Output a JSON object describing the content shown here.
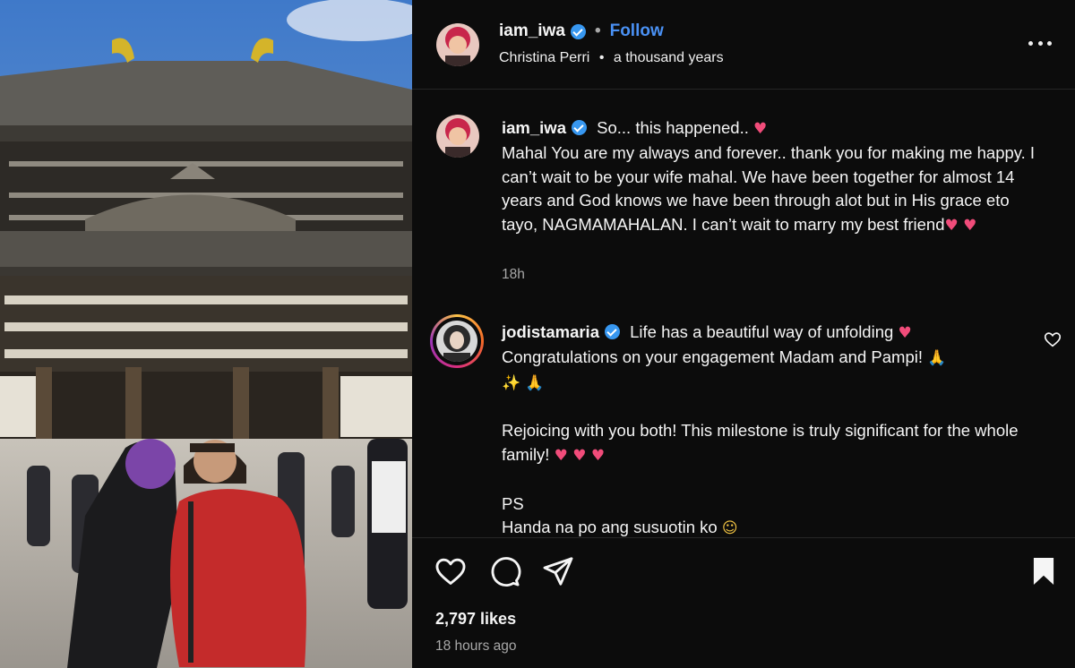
{
  "post": {
    "username": "iam_iwa",
    "follow_label": "Follow",
    "separator": "•",
    "music": {
      "artist": "Christina Perri",
      "song": "a thousand years"
    },
    "more_label": "More options"
  },
  "caption": {
    "username": "iam_iwa",
    "line1_text": "So... this happened..",
    "body": "Mahal You are my always and forever.. thank you for making me happy. I can’t wait to be your wife mahal. We have been together for almost 14 years and God knows we have been through alot but in His grace eto tayo, NAGMAMAHALAN. I can’t wait to marry my best friend",
    "timestamp": "18h"
  },
  "comment": {
    "username": "jodistamaria",
    "line1_text": "Life has a beautiful way of unfolding",
    "line2_text": "Congratulations on your engagement Madam and Pampi!",
    "para2": "Rejoicing with you both! This milestone is truly significant for the whole family!",
    "ps_label": "PS",
    "ps_text": "Handa na po ang susuotin ko"
  },
  "actions": {
    "likes": "2,797 likes",
    "posted_ago": "18 hours ago"
  },
  "icons": {
    "verified": "verified-badge-icon",
    "heart": "heart-emoji",
    "like": "heart-outline-icon",
    "comment": "comment-bubble-icon",
    "share": "paper-plane-icon",
    "save": "bookmark-filled-icon",
    "more": "three-dots-icon"
  },
  "colors": {
    "background": "#0c0c0c",
    "link_blue": "#4a91f4",
    "verified_blue": "#3797f0",
    "heart_pink": "#f14c7a",
    "muted_text": "#a8a8a8"
  }
}
